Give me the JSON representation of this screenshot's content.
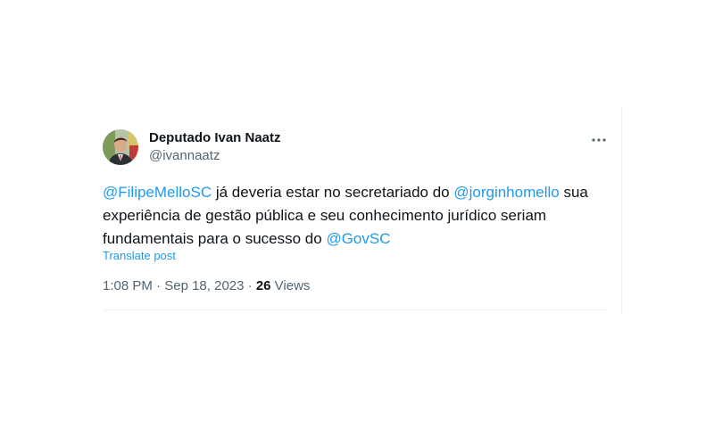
{
  "author": {
    "name": "Deputado Ivan Naatz",
    "handle": "@ivannaatz"
  },
  "tweet": {
    "mention1": "@FilipeMelloSC",
    "text1": " já deveria estar no secretariado do ",
    "mention2": "@jorginhomello",
    "text2": " sua experiência de gestão pública e seu conhecimento jurídico seriam fundamentais para o sucesso do ",
    "mention3": "@GovSC"
  },
  "translate_label": "Translate post",
  "meta": {
    "time": "1:08 PM",
    "sep1": " · ",
    "date": "Sep 18, 2023",
    "sep2": " · ",
    "views_count": "26",
    "views_label": " Views"
  },
  "icons": {
    "more": "more-horizontal-icon"
  },
  "colors": {
    "link": "#1d9bf0",
    "text": "#0f1419",
    "secondary": "#536471"
  }
}
